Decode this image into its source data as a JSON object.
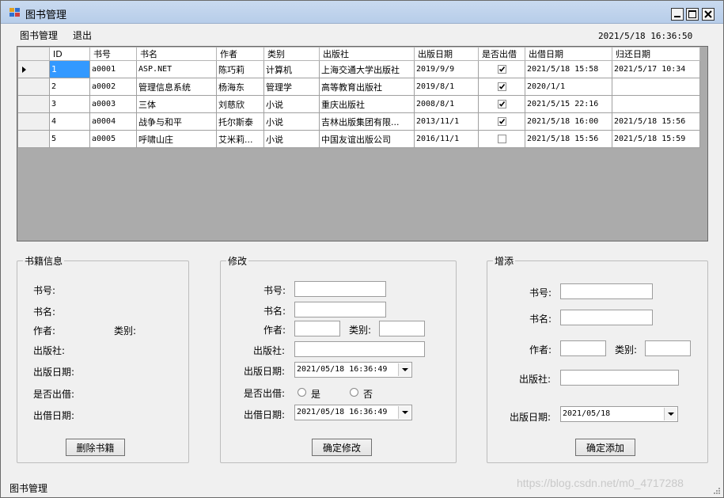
{
  "window": {
    "title": "图书管理",
    "controls": {
      "minimize_icon": "minimize-icon",
      "maximize_icon": "maximize-icon",
      "close_icon": "close-icon"
    }
  },
  "menu": {
    "items": [
      "图书管理",
      "退出"
    ]
  },
  "clock": "2021/5/18 16:36:50",
  "grid": {
    "columns": [
      "ID",
      "书号",
      "书名",
      "作者",
      "类别",
      "出版社",
      "出版日期",
      "是否出借",
      "出借日期",
      "归还日期"
    ],
    "rows": [
      {
        "id": "1",
        "book_no": "a0001",
        "name": "ASP.NET",
        "author": "陈巧莉",
        "category": "计算机",
        "publisher": "上海交通大学出版社",
        "pub_date": "2019/9/9",
        "lent": true,
        "lend_date": "2021/5/18 15:58",
        "return_date": "2021/5/17 10:34"
      },
      {
        "id": "2",
        "book_no": "a0002",
        "name": "管理信息系统",
        "author": "杨海东",
        "category": "管理学",
        "publisher": "高等教育出版社",
        "pub_date": "2019/8/1",
        "lent": true,
        "lend_date": "2020/1/1",
        "return_date": ""
      },
      {
        "id": "3",
        "book_no": "a0003",
        "name": "三体",
        "author": "刘慈欣",
        "category": "小说",
        "publisher": "重庆出版社",
        "pub_date": "2008/8/1",
        "lent": true,
        "lend_date": "2021/5/15 22:16",
        "return_date": ""
      },
      {
        "id": "4",
        "book_no": "a0004",
        "name": "战争与和平",
        "author": "托尔斯泰",
        "category": "小说",
        "publisher": "吉林出版集团有限...",
        "pub_date": "2013/11/1",
        "lent": true,
        "lend_date": "2021/5/18 16:00",
        "return_date": "2021/5/18 15:56"
      },
      {
        "id": "5",
        "book_no": "a0005",
        "name": "呼啸山庄",
        "author": "艾米莉...",
        "category": "小说",
        "publisher": "中国友谊出版公司",
        "pub_date": "2016/11/1",
        "lent": false,
        "lend_date": "2021/5/18 15:56",
        "return_date": "2021/5/18 15:59"
      }
    ]
  },
  "info": {
    "legend": "书籍信息",
    "book_no": "书号:",
    "name": "书名:",
    "author": "作者:",
    "category": "类别:",
    "publisher": "出版社:",
    "pub_date": "出版日期:",
    "lent": "是否出借:",
    "lend_date": "出借日期:",
    "delete_button": "删除书籍"
  },
  "edit": {
    "legend": "修改",
    "book_no": "书号:",
    "name": "书名:",
    "author": "作者:",
    "category": "类别:",
    "publisher": "出版社:",
    "pub_date": "出版日期:",
    "pub_date_value": "2021/05/18  16:36:49",
    "lent": "是否出借:",
    "radio_yes": "是",
    "radio_no": "否",
    "lend_date": "出借日期:",
    "lend_date_value": "2021/05/18  16:36:49",
    "confirm_button": "确定修改"
  },
  "add": {
    "legend": "增添",
    "book_no": "书号:",
    "name": "书名:",
    "author": "作者:",
    "category": "类别:",
    "publisher": "出版社:",
    "pub_date": "出版日期:",
    "pub_date_value": "2021/05/18",
    "confirm_button": "确定添加"
  },
  "status": {
    "text": "图书管理"
  },
  "watermark": "https://blog.csdn.net/m0_4717288",
  "colors": {
    "selection": "#3399ff",
    "grid_background": "#ababab",
    "titlebar": "#c9daf0"
  }
}
